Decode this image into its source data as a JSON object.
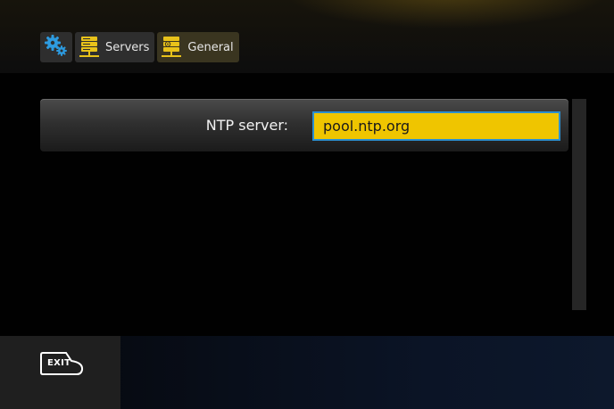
{
  "breadcrumb": {
    "settings_icon": "gears-icon",
    "items": [
      {
        "label": "Servers",
        "icon": "server-stack-icon"
      },
      {
        "label": "General",
        "icon": "server-settings-icon"
      }
    ]
  },
  "setting": {
    "label": "NTP server:",
    "value": "pool.ntp.org"
  },
  "footer": {
    "exit_label": "EXIT",
    "exit_icon": "exit-key-icon"
  },
  "colors": {
    "accent_yellow": "#efc500",
    "focus_blue": "#2b8fd0",
    "icon_blue": "#2d9be0",
    "icon_yellow": "#e8c21a"
  }
}
